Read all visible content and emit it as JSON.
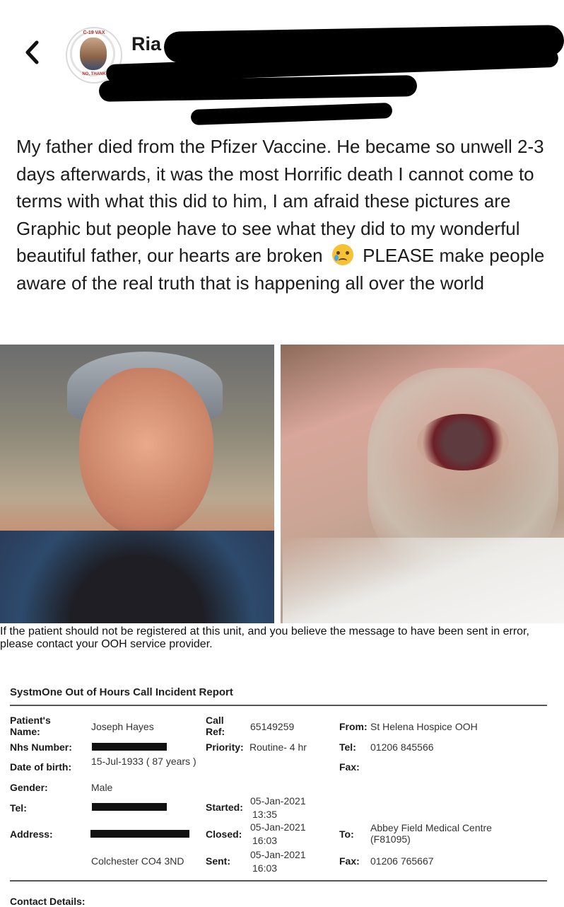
{
  "header": {
    "back_icon": "chevron-left-icon",
    "profile_name": "Ria",
    "avatar_badge_top": "C-19 VAX",
    "avatar_badge_bottom": "NO, THANK"
  },
  "post": {
    "text_before_emoji": "My father died from the Pfizer Vaccine. He became so unwell 2-3 days afterwards, it was the most Horrific death I cannot come to terms with what this did to him, I am afraid these pictures are Graphic but people have to see what they did to my wonderful beautiful father, our hearts are broken",
    "emoji": "crying-face-emoji",
    "text_after_emoji": "PLEASE make people aware of the real truth that is happening all over the world"
  },
  "photos": [
    {
      "name": "portrait-photo",
      "description_icon": "elderly-man-smiling-photo"
    },
    {
      "name": "injury-photo",
      "description_icon": "mouth-closeup-photo"
    }
  ],
  "report": {
    "notice": "If the patient should not be registered at this unit, and you believe the message to have been sent in error, please contact your OOH service provider.",
    "title": "SystmOne Out of Hours Call Incident Report",
    "patient_name_label": "Patient's Name:",
    "patient_name": "Joseph Hayes",
    "nhs_label": "Nhs Number:",
    "dob_label": "Date of birth:",
    "dob": "15-Jul-1933 ( 87 years )",
    "gender_label": "Gender:",
    "gender": "Male",
    "tel_label": "Tel:",
    "address_label": "Address:",
    "address_line2": "Colchester CO4 3ND",
    "call_ref_label": "Call Ref:",
    "call_ref": "65149259",
    "priority_label": "Priority:",
    "priority": "Routine- 4 hr",
    "started_label": "Started:",
    "started_date": "05-Jan-2021",
    "started_time": "13:35",
    "closed_label": "Closed:",
    "closed_date": "05-Jan-2021",
    "closed_time": "16:03",
    "sent_label": "Sent:",
    "sent_date": "05-Jan-2021",
    "sent_time": "16:03",
    "from_label": "From:",
    "from": "St Helena Hospice OOH",
    "tel2_label": "Tel:",
    "tel2": "01206 845566",
    "fax_label": "Fax:",
    "to_label": "To:",
    "to": "Abbey Field Medical Centre (F81095)",
    "fax2_label": "Fax:",
    "fax2": "01206 765667",
    "contact_label": "Contact Details:"
  }
}
